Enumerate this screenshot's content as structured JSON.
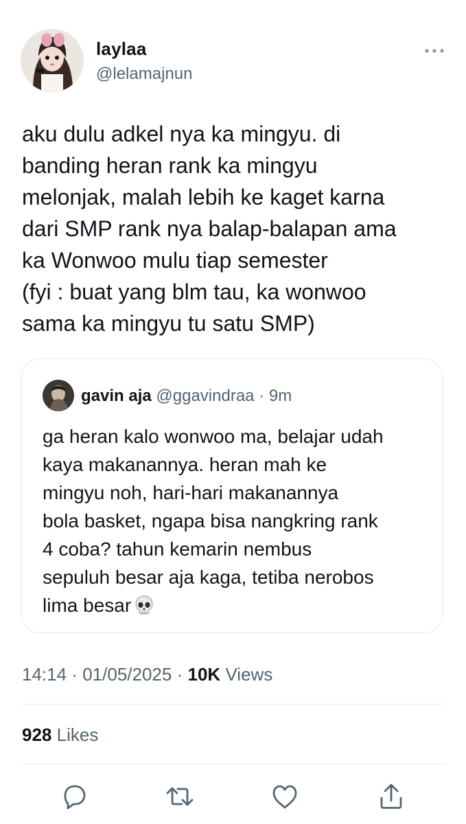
{
  "tweet": {
    "author": {
      "display_name": "laylaa",
      "handle": "@lelamajnun"
    },
    "more_icon": "more-horizontal-icon",
    "text_lines": [
      "aku dulu adkel nya ka mingyu. di",
      "banding heran rank ka mingyu",
      "melonjak, malah lebih ke kaget karna",
      "dari SMP rank nya balap-balapan ama",
      "ka Wonwoo mulu tiap semester",
      "(fyi : buat yang blm tau, ka wonwoo",
      "sama ka mingyu tu satu SMP)"
    ]
  },
  "quote": {
    "display_name": "gavin aja",
    "handle": "@ggavindraa",
    "separator": "·",
    "time": "9m",
    "text_lines": [
      "ga heran kalo wonwoo ma, belajar udah",
      "kaya makanannya. heran mah ke",
      "mingyu noh, hari-hari makanannya",
      "bola basket, ngapa bisa nangkring rank",
      "4 coba? tahun kemarin nembus",
      "sepuluh besar aja kaga, tetiba nerobos",
      "lima besar"
    ],
    "emoji": "skull-emoji"
  },
  "meta": {
    "time": "14:14",
    "separator1": "·",
    "date": "01/05/2025",
    "separator2": "·",
    "views_count": "10K",
    "views_label": "Views"
  },
  "stats": {
    "likes_count": "928",
    "likes_label": "Likes"
  },
  "actions": [
    {
      "icon": "reply-icon"
    },
    {
      "icon": "retweet-icon"
    },
    {
      "icon": "like-icon"
    },
    {
      "icon": "share-icon"
    }
  ],
  "colors": {
    "text_primary": "#0f1419",
    "text_secondary": "#536471",
    "border": "#e1e8ed",
    "divider": "#e6ecf0"
  }
}
